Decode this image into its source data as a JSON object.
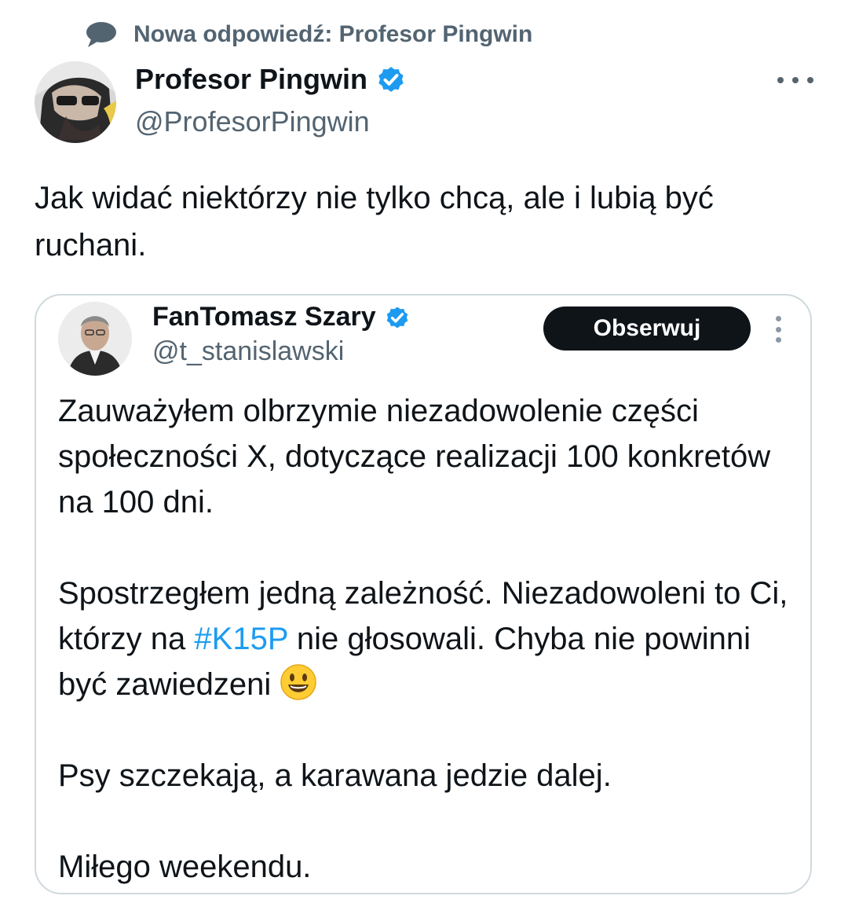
{
  "context": {
    "icon": "reply-bubble-icon",
    "label": "Nowa odpowiedź: Profesor Pingwin"
  },
  "author": {
    "name": "Profesor Pingwin",
    "handle": "@ProfesorPingwin",
    "verified_color": "#1d9bf0"
  },
  "tweet": {
    "text": "Jak widać niektórzy nie tylko chcą, ale i lubią być ruchani."
  },
  "quoted": {
    "name": "FanTomasz Szary",
    "handle": "@t_stanislawski",
    "follow_label": "Obserwuj",
    "para1": "Zauważyłem olbrzymie niezadowolenie części społeczności X, dotyczące realizacji 100 konkretów na 100 dni.",
    "para2_before": "Spostrzegłem jedną zależność. Niezadowoleni to Ci, którzy na ",
    "hashtag": "#K15P",
    "para2_after": " nie głosowali. Chyba nie powinni być zawiedzeni ",
    "para2_emoji": "smiling-face-emoji",
    "para3": "Psy szczekają, a karawana jedzie dalej.",
    "para4": "Miłego weekendu."
  },
  "colors": {
    "text": "#0f1419",
    "secondary": "#536471",
    "link": "#1d9bf0",
    "border": "#cfd9de"
  }
}
